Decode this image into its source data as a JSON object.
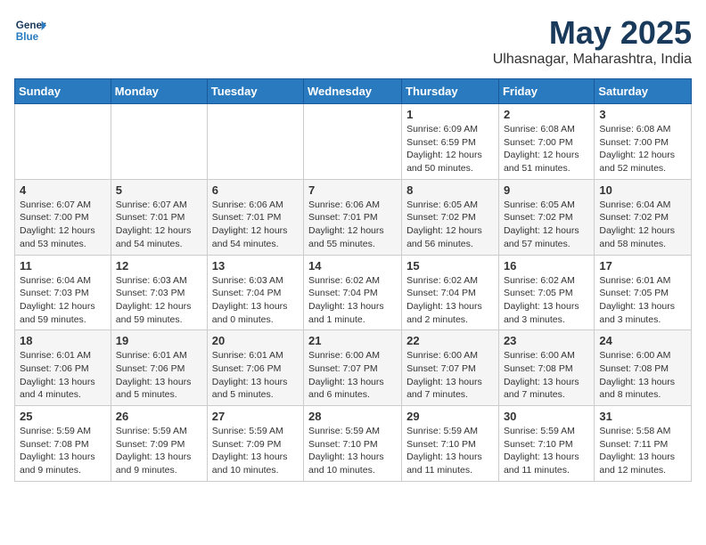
{
  "header": {
    "logo_line1": "General",
    "logo_line2": "Blue",
    "month": "May 2025",
    "location": "Ulhasnagar, Maharashtra, India"
  },
  "weekdays": [
    "Sunday",
    "Monday",
    "Tuesday",
    "Wednesday",
    "Thursday",
    "Friday",
    "Saturday"
  ],
  "weeks": [
    [
      {
        "day": "",
        "info": ""
      },
      {
        "day": "",
        "info": ""
      },
      {
        "day": "",
        "info": ""
      },
      {
        "day": "",
        "info": ""
      },
      {
        "day": "1",
        "info": "Sunrise: 6:09 AM\nSunset: 6:59 PM\nDaylight: 12 hours\nand 50 minutes."
      },
      {
        "day": "2",
        "info": "Sunrise: 6:08 AM\nSunset: 7:00 PM\nDaylight: 12 hours\nand 51 minutes."
      },
      {
        "day": "3",
        "info": "Sunrise: 6:08 AM\nSunset: 7:00 PM\nDaylight: 12 hours\nand 52 minutes."
      }
    ],
    [
      {
        "day": "4",
        "info": "Sunrise: 6:07 AM\nSunset: 7:00 PM\nDaylight: 12 hours\nand 53 minutes."
      },
      {
        "day": "5",
        "info": "Sunrise: 6:07 AM\nSunset: 7:01 PM\nDaylight: 12 hours\nand 54 minutes."
      },
      {
        "day": "6",
        "info": "Sunrise: 6:06 AM\nSunset: 7:01 PM\nDaylight: 12 hours\nand 54 minutes."
      },
      {
        "day": "7",
        "info": "Sunrise: 6:06 AM\nSunset: 7:01 PM\nDaylight: 12 hours\nand 55 minutes."
      },
      {
        "day": "8",
        "info": "Sunrise: 6:05 AM\nSunset: 7:02 PM\nDaylight: 12 hours\nand 56 minutes."
      },
      {
        "day": "9",
        "info": "Sunrise: 6:05 AM\nSunset: 7:02 PM\nDaylight: 12 hours\nand 57 minutes."
      },
      {
        "day": "10",
        "info": "Sunrise: 6:04 AM\nSunset: 7:02 PM\nDaylight: 12 hours\nand 58 minutes."
      }
    ],
    [
      {
        "day": "11",
        "info": "Sunrise: 6:04 AM\nSunset: 7:03 PM\nDaylight: 12 hours\nand 59 minutes."
      },
      {
        "day": "12",
        "info": "Sunrise: 6:03 AM\nSunset: 7:03 PM\nDaylight: 12 hours\nand 59 minutes."
      },
      {
        "day": "13",
        "info": "Sunrise: 6:03 AM\nSunset: 7:04 PM\nDaylight: 13 hours\nand 0 minutes."
      },
      {
        "day": "14",
        "info": "Sunrise: 6:02 AM\nSunset: 7:04 PM\nDaylight: 13 hours\nand 1 minute."
      },
      {
        "day": "15",
        "info": "Sunrise: 6:02 AM\nSunset: 7:04 PM\nDaylight: 13 hours\nand 2 minutes."
      },
      {
        "day": "16",
        "info": "Sunrise: 6:02 AM\nSunset: 7:05 PM\nDaylight: 13 hours\nand 3 minutes."
      },
      {
        "day": "17",
        "info": "Sunrise: 6:01 AM\nSunset: 7:05 PM\nDaylight: 13 hours\nand 3 minutes."
      }
    ],
    [
      {
        "day": "18",
        "info": "Sunrise: 6:01 AM\nSunset: 7:06 PM\nDaylight: 13 hours\nand 4 minutes."
      },
      {
        "day": "19",
        "info": "Sunrise: 6:01 AM\nSunset: 7:06 PM\nDaylight: 13 hours\nand 5 minutes."
      },
      {
        "day": "20",
        "info": "Sunrise: 6:01 AM\nSunset: 7:06 PM\nDaylight: 13 hours\nand 5 minutes."
      },
      {
        "day": "21",
        "info": "Sunrise: 6:00 AM\nSunset: 7:07 PM\nDaylight: 13 hours\nand 6 minutes."
      },
      {
        "day": "22",
        "info": "Sunrise: 6:00 AM\nSunset: 7:07 PM\nDaylight: 13 hours\nand 7 minutes."
      },
      {
        "day": "23",
        "info": "Sunrise: 6:00 AM\nSunset: 7:08 PM\nDaylight: 13 hours\nand 7 minutes."
      },
      {
        "day": "24",
        "info": "Sunrise: 6:00 AM\nSunset: 7:08 PM\nDaylight: 13 hours\nand 8 minutes."
      }
    ],
    [
      {
        "day": "25",
        "info": "Sunrise: 5:59 AM\nSunset: 7:08 PM\nDaylight: 13 hours\nand 9 minutes."
      },
      {
        "day": "26",
        "info": "Sunrise: 5:59 AM\nSunset: 7:09 PM\nDaylight: 13 hours\nand 9 minutes."
      },
      {
        "day": "27",
        "info": "Sunrise: 5:59 AM\nSunset: 7:09 PM\nDaylight: 13 hours\nand 10 minutes."
      },
      {
        "day": "28",
        "info": "Sunrise: 5:59 AM\nSunset: 7:10 PM\nDaylight: 13 hours\nand 10 minutes."
      },
      {
        "day": "29",
        "info": "Sunrise: 5:59 AM\nSunset: 7:10 PM\nDaylight: 13 hours\nand 11 minutes."
      },
      {
        "day": "30",
        "info": "Sunrise: 5:59 AM\nSunset: 7:10 PM\nDaylight: 13 hours\nand 11 minutes."
      },
      {
        "day": "31",
        "info": "Sunrise: 5:58 AM\nSunset: 7:11 PM\nDaylight: 13 hours\nand 12 minutes."
      }
    ]
  ]
}
